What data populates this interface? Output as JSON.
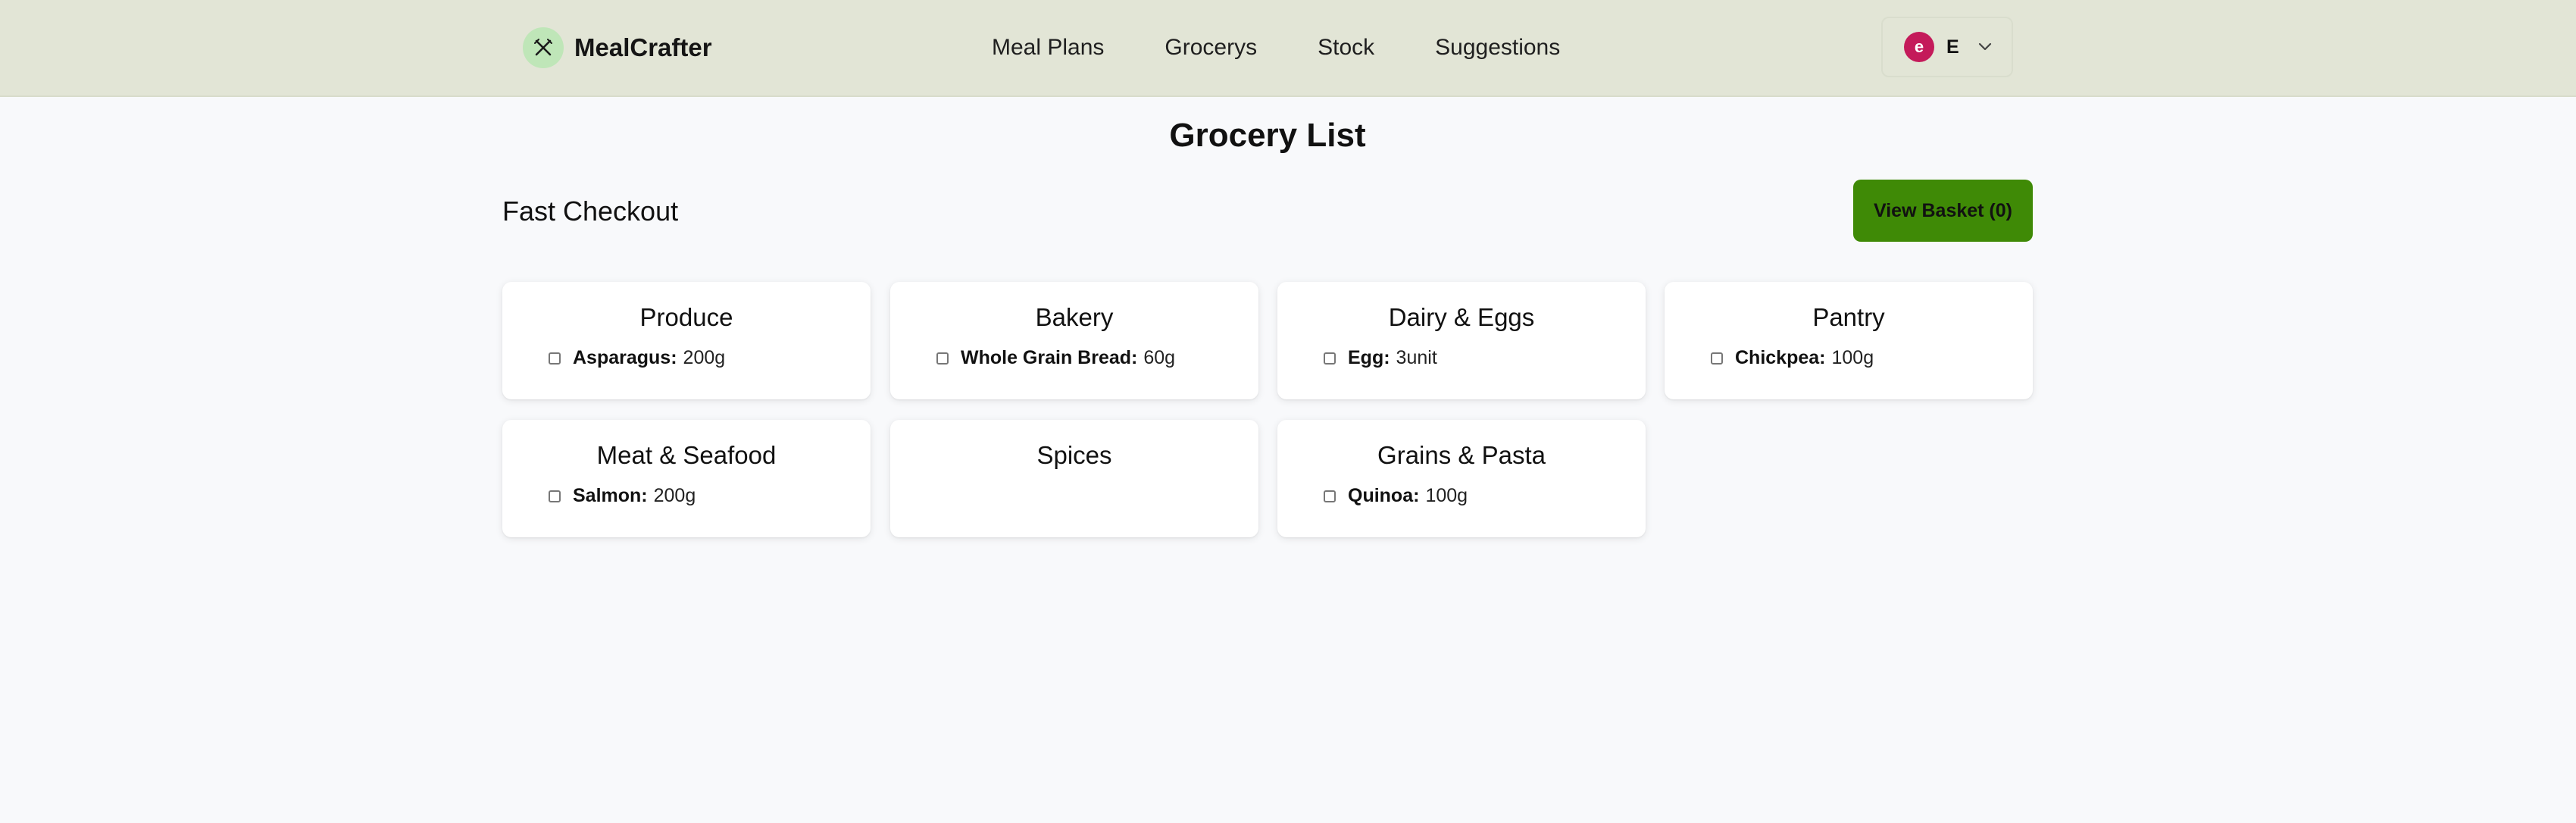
{
  "app": {
    "name": "MealCrafter"
  },
  "nav": {
    "links": [
      "Meal Plans",
      "Grocerys",
      "Stock",
      "Suggestions"
    ]
  },
  "user": {
    "avatar_letter": "e",
    "initial": "E"
  },
  "page": {
    "title": "Grocery List"
  },
  "checkout": {
    "title": "Fast Checkout",
    "basket_label": "View Basket (0)",
    "basket_color": "#3f8a06"
  },
  "categories": [
    {
      "title": "Produce",
      "items": [
        {
          "name": "Asparagus",
          "qty": "200g"
        }
      ]
    },
    {
      "title": "Bakery",
      "items": [
        {
          "name": "Whole Grain Bread",
          "qty": "60g"
        }
      ]
    },
    {
      "title": "Dairy & Eggs",
      "items": [
        {
          "name": "Egg",
          "qty": "3unit"
        }
      ]
    },
    {
      "title": "Pantry",
      "items": [
        {
          "name": "Chickpea",
          "qty": "100g"
        }
      ]
    },
    {
      "title": "Meat & Seafood",
      "items": [
        {
          "name": "Salmon",
          "qty": "200g"
        }
      ]
    },
    {
      "title": "Spices",
      "items": []
    },
    {
      "title": "Grains & Pasta",
      "items": [
        {
          "name": "Quinoa",
          "qty": "100g"
        }
      ]
    }
  ],
  "colors": {
    "navbar": "#e2e5d6",
    "avatar": "#c41a5a",
    "accent": "#3f8a06"
  }
}
